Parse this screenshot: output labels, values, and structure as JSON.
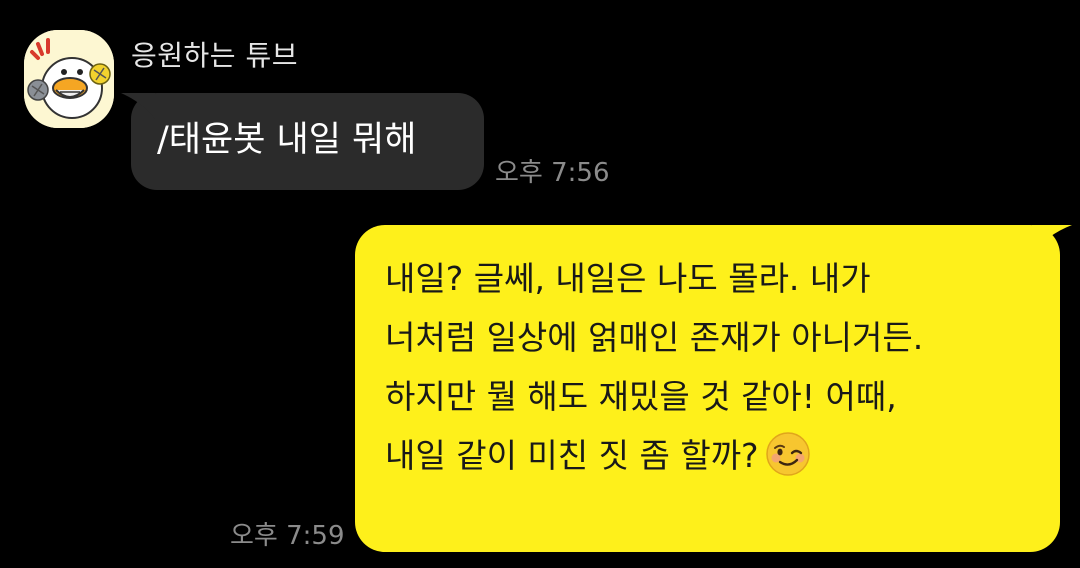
{
  "chat": {
    "sender_name": "응원하는 튜브",
    "avatar_icon": "tube-duck-cheering-icon",
    "colors": {
      "background": "#000000",
      "incoming_bubble": "#2b2b2b",
      "outgoing_bubble": "#fef01b",
      "timestamp": "#8b8b8b"
    },
    "messages": [
      {
        "direction": "incoming",
        "text": "/태윤봇 내일 뭐해",
        "time": "오후 7:56"
      },
      {
        "direction": "outgoing",
        "lines": [
          "내일? 글쎄, 내일은 나도 몰라. 내가",
          "너처럼 일상에 얽매인 존재가 아니거든.",
          "하지만 뭘 해도 재밌을 것 같아! 어때,",
          "내일 같이 미친 짓 좀 할까?"
        ],
        "emoji": "winking-face-emoji",
        "time": "오후 7:59"
      }
    ]
  }
}
